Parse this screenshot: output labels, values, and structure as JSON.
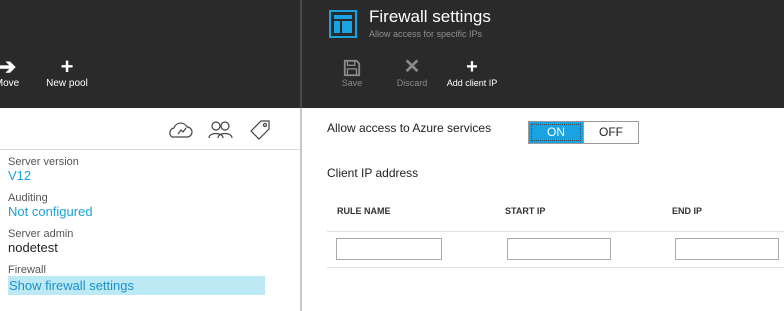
{
  "left_blade": {
    "commands": [
      {
        "label": "Move",
        "icon": "arrow-right-icon"
      },
      {
        "label": "New pool",
        "icon": "plus-icon"
      }
    ],
    "icons": [
      "cloud-icon",
      "users-icon",
      "tag-icon"
    ],
    "properties": [
      {
        "label": "Server version",
        "value": "V12"
      },
      {
        "label": "Auditing",
        "value": "Not configured"
      },
      {
        "label": "Server admin",
        "value": "nodetest"
      },
      {
        "label": "Firewall",
        "value": "Show firewall settings"
      }
    ]
  },
  "firewall_blade": {
    "title": "Firewall settings",
    "subtitle": "Allow access for specific IPs",
    "icon": "firewall-blade-icon",
    "commands": [
      {
        "label": "Save",
        "icon": "save-icon",
        "enabled": false
      },
      {
        "label": "Discard",
        "icon": "discard-icon",
        "enabled": false
      },
      {
        "label": "Add client IP",
        "icon": "plus-icon",
        "enabled": true
      }
    ],
    "azure_access": {
      "label": "Allow access to Azure services",
      "on_label": "ON",
      "off_label": "OFF",
      "selected": "ON"
    },
    "client_ip_label": "Client IP address",
    "table": {
      "columns": [
        "RULE NAME",
        "START IP",
        "END IP"
      ],
      "new_row": {
        "rule_name": "",
        "start_ip": "",
        "end_ip": ""
      }
    }
  },
  "colors": {
    "header_bg": "#2a2a2a",
    "accent": "#1aa3e0",
    "link": "#1aa3d6",
    "highlight_bg": "#bde9f5"
  }
}
